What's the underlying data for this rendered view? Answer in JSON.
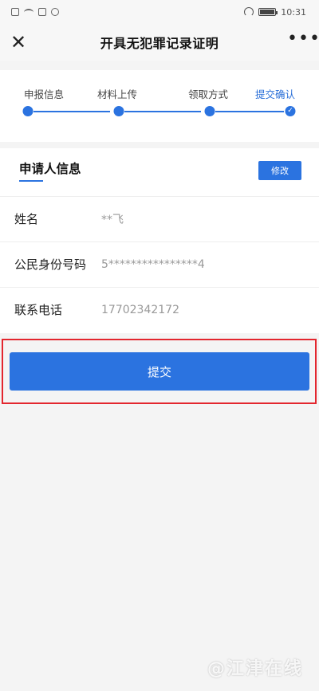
{
  "status_bar": {
    "time": "10:31",
    "battery_level": "100"
  },
  "nav": {
    "title": "开具无犯罪记录证明",
    "close_icon": "✕",
    "more_icon": "•••"
  },
  "steps": [
    {
      "label": "申报信息"
    },
    {
      "label": "材料上传"
    },
    {
      "label": "领取方式"
    },
    {
      "label": "提交确认"
    }
  ],
  "applicant": {
    "section_title": "申请人信息",
    "edit_label": "修改",
    "rows": [
      {
        "label": "姓名",
        "value": "**飞"
      },
      {
        "label": "公民身份号码",
        "value": "5****************4"
      },
      {
        "label": "联系电话",
        "value": "17702342172"
      }
    ]
  },
  "submit_label": "提交",
  "watermark": "@江津在线",
  "colors": {
    "accent": "#2b73e0",
    "highlight_border": "#e3262e",
    "background": "#f4f4f4"
  }
}
